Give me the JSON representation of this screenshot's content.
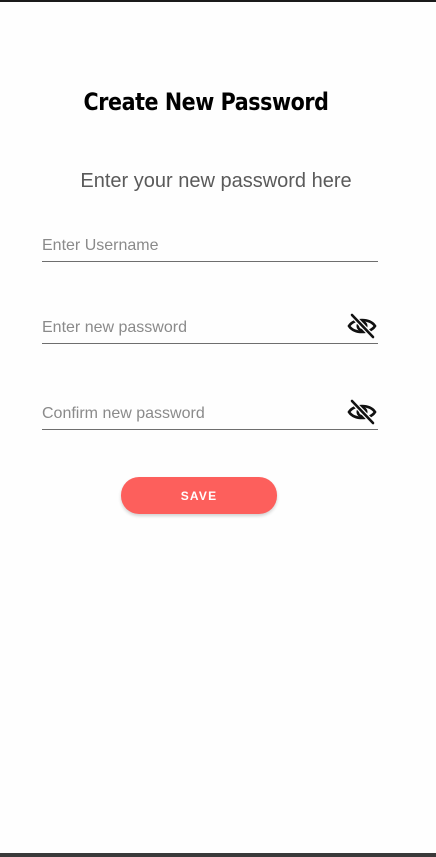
{
  "title": "Create New Password",
  "subtitle": "Enter your new password here",
  "fields": {
    "username": {
      "placeholder": "Enter Username",
      "value": ""
    },
    "new_password": {
      "placeholder": "Enter new password",
      "value": "",
      "toggle_icon": "eye-off-icon"
    },
    "confirm_password": {
      "placeholder": "Confirm new password",
      "value": "",
      "toggle_icon": "eye-off-icon"
    }
  },
  "save_button": {
    "label": "SAVE"
  },
  "colors": {
    "accent": "#fd5f5c",
    "title": "#000000",
    "subtitle": "#5a5a5a",
    "underline": "#6e6e6e",
    "placeholder": "#8a8a8a",
    "background": "#fefefe"
  }
}
